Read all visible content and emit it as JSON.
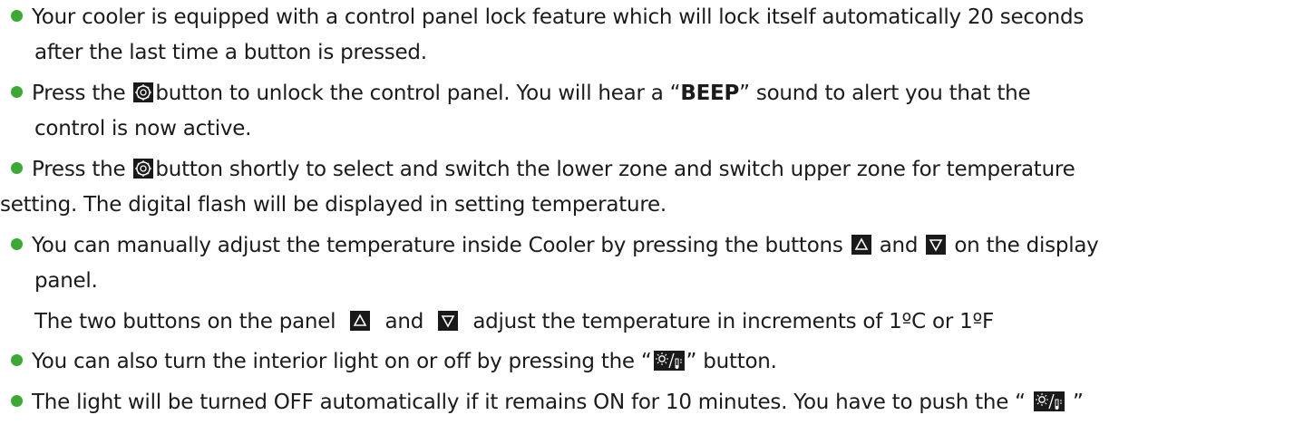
{
  "lines": {
    "l1": "Your cooler is equipped with a control panel lock feature which will lock itself automatically 20 seconds",
    "l2": "after the last time a button is pressed.",
    "l3a": "Press the",
    "l3b": "button to unlock the control panel. You will hear a “",
    "l3c": "BEEP",
    "l3d": "” sound to alert you that the",
    "l4": "control is now active.",
    "l5a": "Press the",
    "l5b": "button shortly to select and switch the lower zone and switch upper zone for temperature",
    "l6": "setting. The digital flash will be displayed in setting temperature.",
    "l7a": "You can manually adjust the temperature inside Cooler by pressing the buttons",
    "l7b": "and",
    "l7c": "on the display",
    "l8": "panel.",
    "l9a": "The two buttons on the panel",
    "l9b": "and",
    "l9c": "adjust the temperature in increments of 1ºC or 1ºF",
    "l10a": "You can also turn the interior light on or off by pressing the “",
    "l10b": "” button.",
    "l11a": "The light will be turned OFF automatically if it remains ON for 10 minutes. You have to push the “",
    "l11b": "”"
  },
  "icons": {
    "zone": "zone-select-icon",
    "up": "triangle-up-icon",
    "down": "triangle-down-icon",
    "light": "light-temp-icon"
  },
  "colors": {
    "bullet": "#3aaa35",
    "text": "#1b1b1b",
    "icon_bg": "#1a1a1a"
  }
}
